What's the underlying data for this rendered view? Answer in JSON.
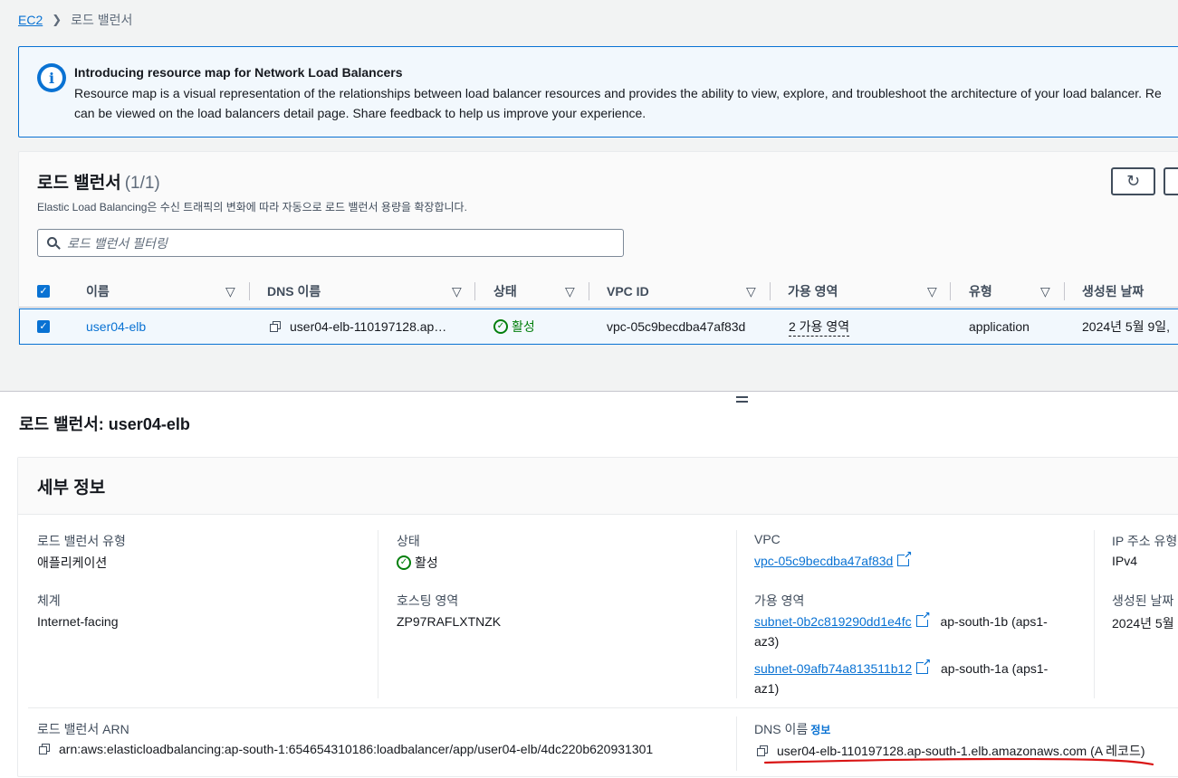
{
  "breadcrumb": {
    "root": "EC2",
    "separator": ">",
    "current": "로드 밸런서"
  },
  "banner": {
    "title": "Introducing resource map for Network Load Balancers",
    "body_line1": "Resource map is a visual representation of the relationships between load balancer resources and provides the ability to view, explore, and troubleshoot the architecture of your load balancer. Re",
    "body_line2": "can be viewed on the load balancers detail page. Share feedback to help us improve your experience."
  },
  "list": {
    "title": "로드 밸런서",
    "count": "(1/1)",
    "description": "Elastic Load Balancing은 수신 트래픽의 변화에 따라 자동으로 로드 밸런서 용량을 확장합니다.",
    "filter_placeholder": "로드 밸런서 필터링",
    "columns": [
      "이름",
      "DNS 이름",
      "상태",
      "VPC ID",
      "가용 영역",
      "유형",
      "생성된 날짜"
    ],
    "rows": [
      {
        "name": "user04-elb",
        "dns": "user04-elb-110197128.ap…",
        "state": "활성",
        "vpc": "vpc-05c9becdba47af83d",
        "az": "2 가용 영역",
        "type": "application",
        "created": "2024년 5월 9일,"
      }
    ]
  },
  "detail": {
    "heading": "로드 밸런서: user04-elb",
    "panel_title": "세부 정보",
    "lb_type_label": "로드 밸런서 유형",
    "lb_type_value": "애플리케이션",
    "scheme_label": "체계",
    "scheme_value": "Internet-facing",
    "state_label": "상태",
    "state_value": "활성",
    "hosted_zone_label": "호스팅 영역",
    "hosted_zone_value": "ZP97RAFLXTNZK",
    "vpc_label": "VPC",
    "vpc_value": "vpc-05c9becdba47af83d",
    "az_label": "가용 영역",
    "subnet1": "subnet-0b2c819290dd1e4fc",
    "subnet1_zone": "ap-south-1b (aps1-",
    "subnet1_zone2": "az3)",
    "subnet2": "subnet-09afb74a813511b12",
    "subnet2_zone": "ap-south-1a (aps1-",
    "subnet2_zone2": "az1)",
    "ip_type_label": "IP 주소 유형",
    "ip_type_value": "IPv4",
    "created_label": "생성된 날짜",
    "created_value": "2024년 5월",
    "arn_label": "로드 밸런서 ARN",
    "arn_value": "arn:aws:elasticloadbalancing:ap-south-1:654654310186:loadbalancer/app/user04-elb/4dc220b620931301",
    "dns_label": "DNS 이름",
    "dns_info": "정보",
    "dns_value": "user04-elb-110197128.ap-south-1.elb.amazonaws.com (A 레코드)"
  },
  "colors": {
    "accent": "#0972d3",
    "success": "#037f0c",
    "annotation": "#d91515"
  },
  "icons": [
    "chevron-right-icon",
    "info-icon",
    "refresh-icon",
    "search-icon",
    "sort-icon",
    "checkbox-checked-icon",
    "copy-icon",
    "status-ok-icon",
    "external-link-icon",
    "drag-handle-icon"
  ]
}
